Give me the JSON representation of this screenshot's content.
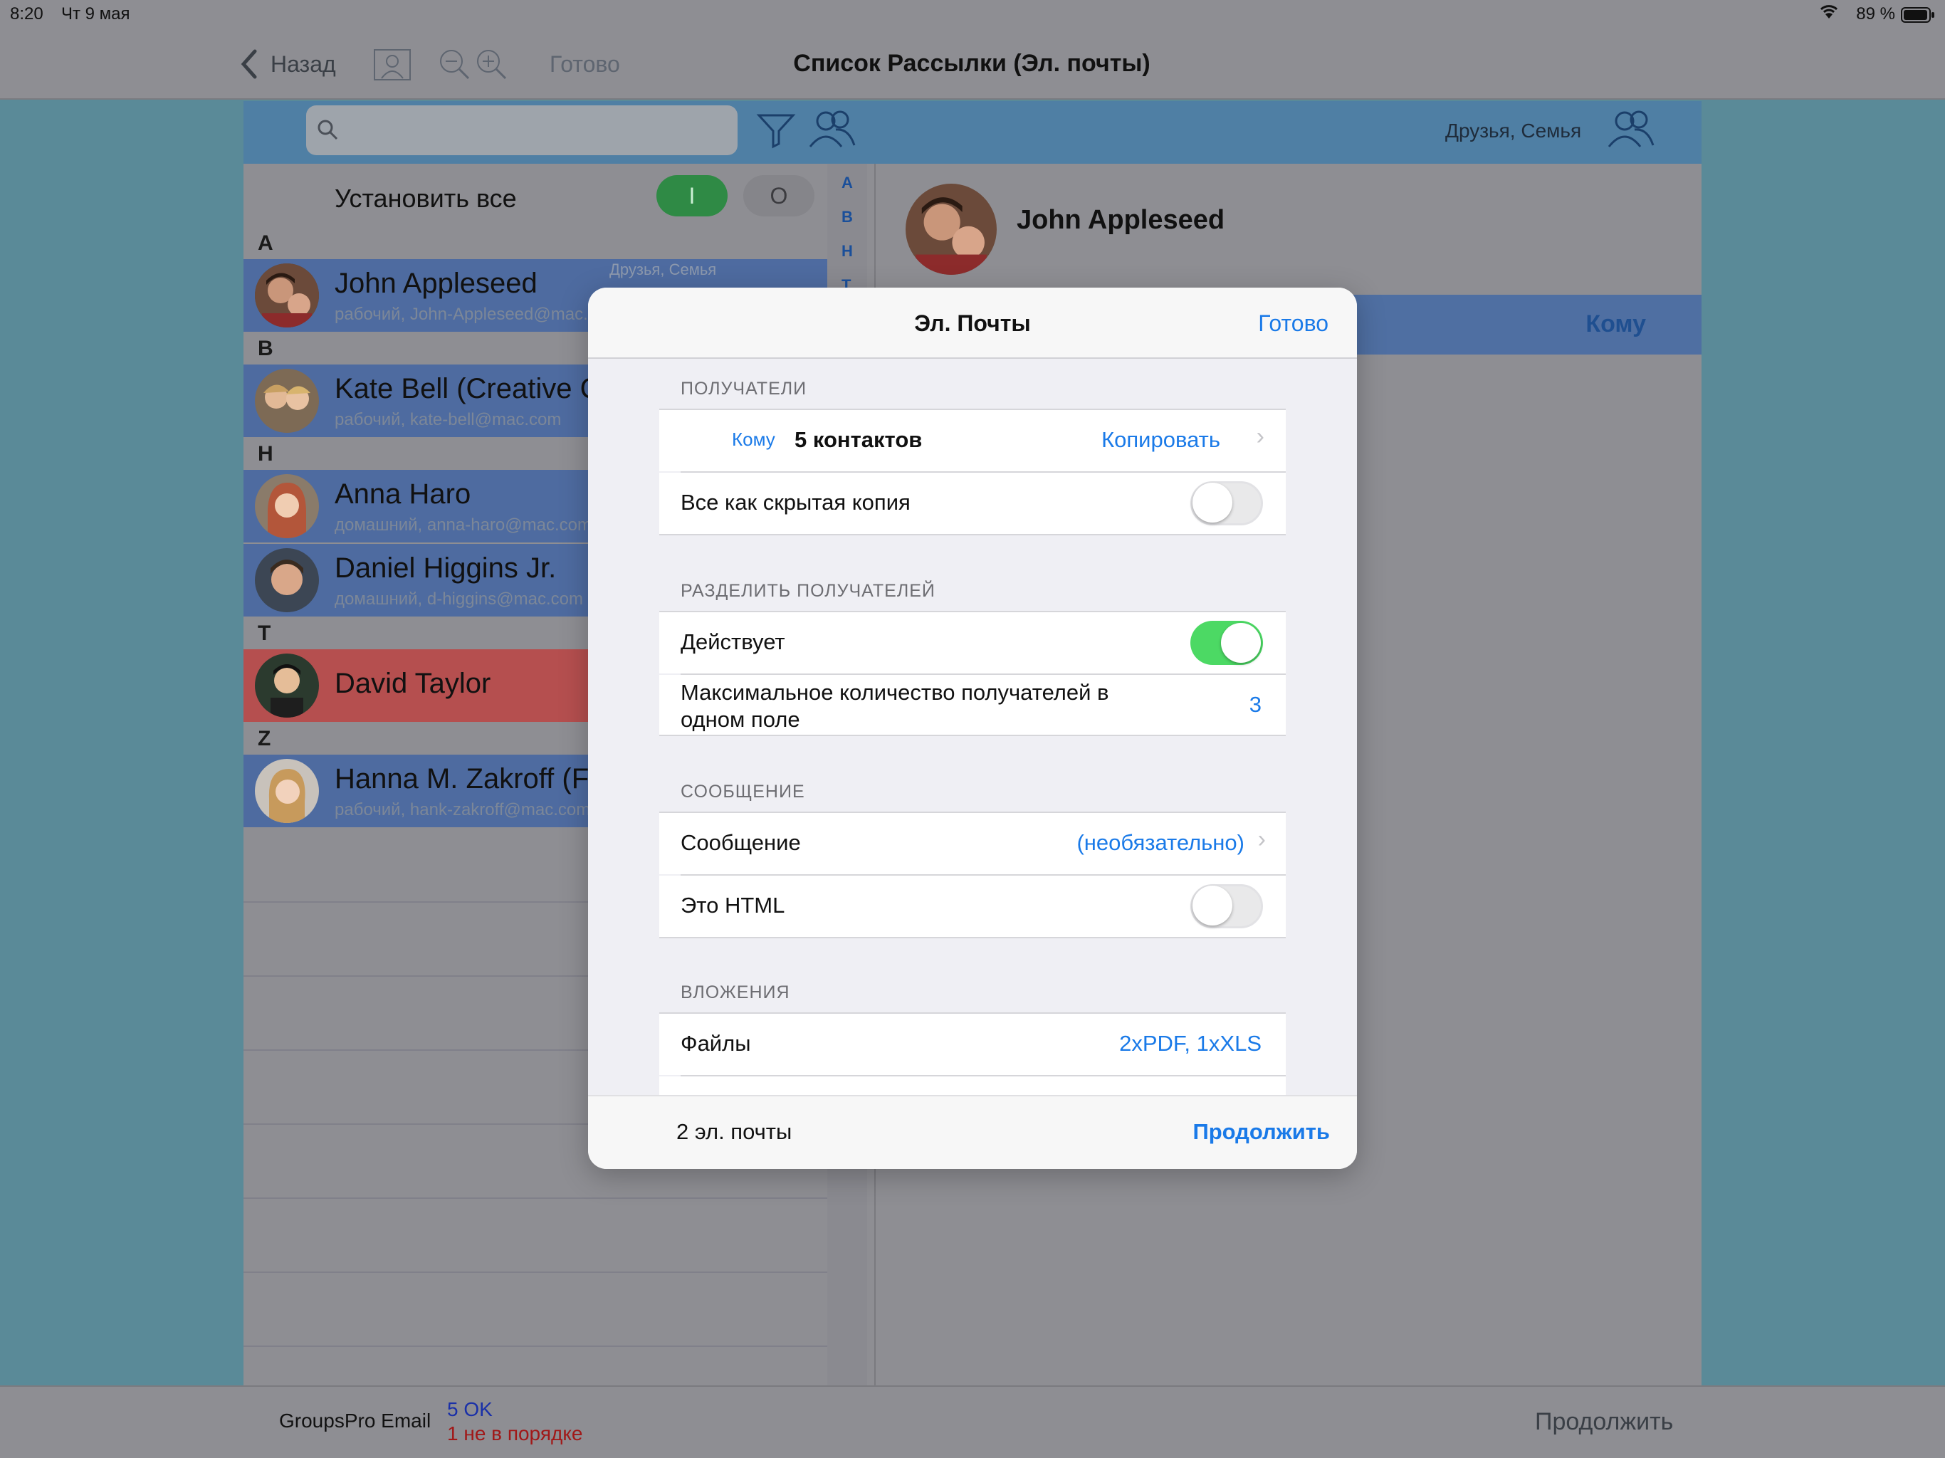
{
  "status": {
    "time": "8:20",
    "date": "Чт 9 мая",
    "battery": "89 %"
  },
  "nav": {
    "back": "Назад",
    "done": "Готово",
    "title": "Список Рассылки (Эл. почты)"
  },
  "toolbar": {
    "groups_label": "Друзья, Семья"
  },
  "left": {
    "set_all": "Установить все",
    "toggle_on": "I",
    "toggle_off": "O",
    "index": [
      "A",
      "B",
      "H",
      "T"
    ],
    "sections": [
      "A",
      "B",
      "H",
      "T",
      "Z"
    ],
    "contacts": [
      {
        "name": "John Appleseed",
        "sub": "рабочий, John-Appleseed@mac.com",
        "groups": "Друзья, Семья"
      },
      {
        "name": "Kate Bell (Creative Consulting)",
        "sub": "рабочий, kate-bell@mac.com"
      },
      {
        "name": "Anna Haro",
        "sub": "домашний, anna-haro@mac.com"
      },
      {
        "name": "Daniel Higgins Jr.",
        "sub": "домашний, d-higgins@mac.com"
      },
      {
        "name": "David Taylor",
        "sub": ""
      },
      {
        "name": "Hanna M. Zakroff (Finance)",
        "sub": "рабочий, hank-zakroff@mac.com"
      }
    ]
  },
  "right": {
    "contact_name": "John Appleseed",
    "to_label": "Кому"
  },
  "bottom": {
    "app": "GroupsPro Email",
    "ok": "5 OK",
    "not_ok": "1 не в порядке",
    "continue": "Продолжить"
  },
  "modal": {
    "title": "Эл. Почты",
    "done": "Готово",
    "sec_recipients": "ПОЛУЧАТЕЛИ",
    "to_small": "Кому",
    "to_count": "5 контактов",
    "copy": "Копировать",
    "all_bcc": "Все как скрытая копия",
    "sec_split": "РАЗДЕЛИТЬ ПОЛУЧАТЕЛЕЙ",
    "active": "Действует",
    "max_label": "Максимальное количество получателей в одном поле",
    "max_value": "3",
    "sec_message": "СООБЩЕНИЕ",
    "message": "Сообщение",
    "message_value": "(необязательно)",
    "is_html": "Это HTML",
    "sec_attach": "ВЛОЖЕНИЯ",
    "files": "Файлы",
    "files_value": "2xPDF, 1xXLS",
    "count": "2 эл. почты",
    "continue": "Продолжить"
  },
  "colors": {
    "accent": "#1a7ae8",
    "toggle_on": "#4cd964",
    "highlight_blue": "#4e6ba0",
    "highlight_red": "#b54f4f"
  }
}
